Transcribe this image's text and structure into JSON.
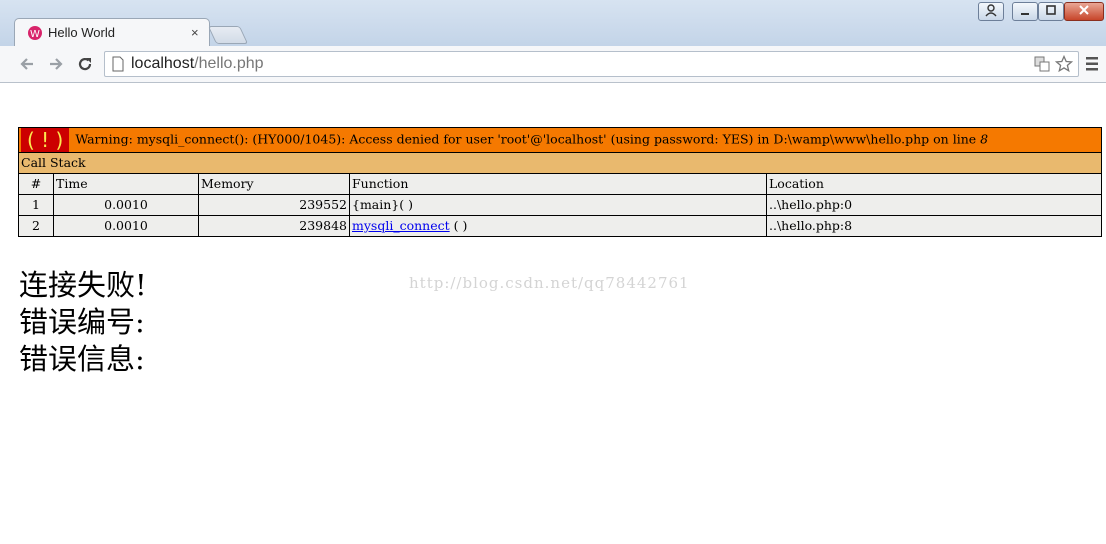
{
  "browser": {
    "tab_title": "Hello World",
    "tab_close": "×",
    "url_host": "localhost",
    "url_path": "/hello.php"
  },
  "xdebug": {
    "badge": "( ! )",
    "warning": "Warning: mysqli_connect(): (HY000/1045): Access denied for user 'root'@'localhost' (using password: YES) in D:\\wamp\\www\\hello.php on line",
    "line": "8",
    "call_stack_title": "Call Stack",
    "columns": [
      "#",
      "Time",
      "Memory",
      "Function",
      "Location"
    ],
    "rows": [
      {
        "num": "1",
        "time": "0.0010",
        "memory": "239552",
        "function": "{main}( )",
        "location": "..\\hello.php:0"
      },
      {
        "num": "2",
        "time": "0.0010",
        "memory": "239848",
        "function_link": "mysqli_connect",
        "function_suffix": " ( )",
        "location": "..\\hello.php:8"
      }
    ]
  },
  "page": {
    "line1": "连接失败!",
    "line2": "错误编号:",
    "line3": "错误信息:"
  },
  "watermark": "http://blog.csdn.net/qq78442761",
  "colors": {
    "warning_bg": "#f57900",
    "badge_bg": "#cc0000",
    "callstack_bg": "#e9b96e",
    "row_bg": "#eeeeec",
    "link": "#0000ee"
  },
  "icons": [
    "user-icon",
    "minimize-icon",
    "maximize-icon",
    "close-icon",
    "favicon-icon",
    "back-icon",
    "forward-icon",
    "reload-icon",
    "page-icon",
    "translate-icon",
    "star-icon",
    "menu-icon"
  ]
}
